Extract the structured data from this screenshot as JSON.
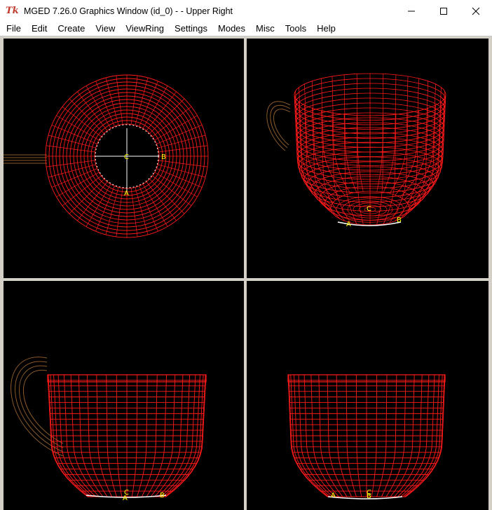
{
  "window": {
    "icon_text": "Tk",
    "title": "MGED 7.26.0 Graphics Window (id_0) -  - Upper Right"
  },
  "menu": {
    "items": [
      "File",
      "Edit",
      "Create",
      "View",
      "ViewRing",
      "Settings",
      "Modes",
      "Misc",
      "Tools",
      "Help"
    ]
  },
  "viewports": {
    "top_left": {
      "view": "top",
      "labels": {
        "a": "A",
        "b": "B",
        "c": "C"
      }
    },
    "top_right": {
      "view": "perspective",
      "labels": {
        "a": "A",
        "b": "B",
        "c": "C"
      }
    },
    "bottom_left": {
      "view": "side",
      "labels": {
        "a": "A",
        "b": "B",
        "c": "C"
      }
    },
    "bottom_right": {
      "view": "front",
      "labels": {
        "a": "A",
        "b": "B",
        "c": "C"
      }
    }
  },
  "colors": {
    "wire": "#ff1a1a",
    "handle": "#8a5a2a",
    "highlight": "#ffffff",
    "label": "#ffff00",
    "background": "#000000"
  }
}
